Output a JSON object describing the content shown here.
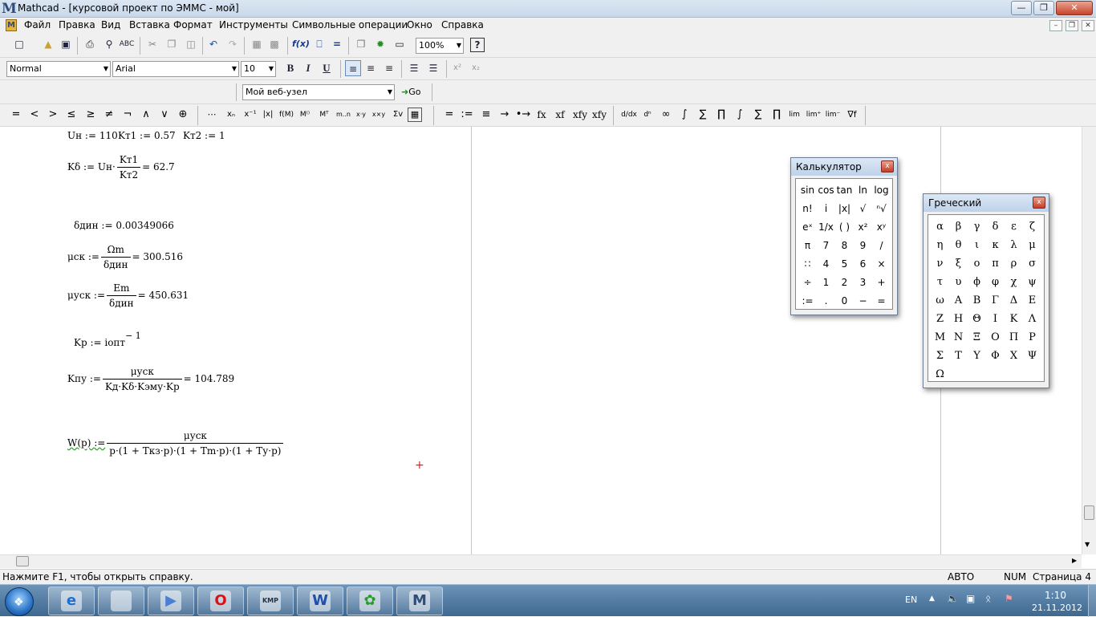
{
  "window": {
    "title": "Mathcad - [курсовой проект по ЭММС - мой]",
    "app_logo": "M",
    "controls": [
      "—",
      "❐",
      "✕"
    ]
  },
  "menu": [
    "Файл",
    "Правка",
    "Вид",
    "Вставка",
    "Формат",
    "Инструменты",
    "Символьные операции",
    "Окно",
    "Справка"
  ],
  "doc_controls": [
    "–",
    "❐",
    "✕"
  ],
  "toolbar": {
    "zoom": "100%",
    "help": "?"
  },
  "format_bar": {
    "style": "Normal",
    "font": "Arial",
    "size": "10",
    "bold": "B",
    "italic": "I",
    "underline": "U",
    "superscript": "x²",
    "subscript": "x₂"
  },
  "web_bar": {
    "site": "Мой веб-узел",
    "go": "Go"
  },
  "math_bar": {
    "boolean": [
      "=",
      "<",
      ">",
      "≤",
      "≥",
      "≠",
      "¬",
      "∧",
      "∨",
      "⊕"
    ],
    "evaluation": [
      "=",
      ":=",
      "≡",
      "→",
      "•→",
      "fx",
      "xf",
      "xfy",
      "xfy"
    ],
    "calculus": [
      "∫",
      "∑",
      "∏",
      "lim"
    ]
  },
  "worksheet": {
    "line1": {
      "a": "Uн := 110",
      "b": "Kт1 := 0.57",
      "c": "Kт2 := 1"
    },
    "kd": {
      "lhs": "Kδ := Uн·",
      "num": "Kт1",
      "den": "Kт2",
      "rhs": "= 62.7"
    },
    "ddin": "δдин := 0.00349066",
    "mu_sk": {
      "lhs": "μск :=",
      "num": "Ωm",
      "den": "δдин",
      "rhs": "= 300.516"
    },
    "mu_usk": {
      "lhs": "μуск :=",
      "num": "Em",
      "den": "δдин",
      "rhs": "= 450.631"
    },
    "kp": {
      "lhs": "Kp := iопт",
      "exp": "− 1"
    },
    "kpu": {
      "lhs": "Kпу :=",
      "num": "μуск",
      "den": "Kд·Kδ·Kэму·Kp",
      "rhs": "= 104.789"
    },
    "w": {
      "lhs": "W(p) :=",
      "num": "μуск",
      "den": "p·(1 + Tкз·p)·(1 + Tm·p)·(1 + Tу·p)"
    },
    "cursor": "+"
  },
  "calculator": {
    "title": "Калькулятор",
    "close": "x",
    "keys": [
      [
        "sin",
        "cos",
        "tan",
        "ln",
        "log"
      ],
      [
        "n!",
        "i",
        "|x|",
        "√",
        "ⁿ√"
      ],
      [
        "eˣ",
        "1/x",
        "( )",
        "x²",
        "xʸ"
      ],
      [
        "π",
        "7",
        "8",
        "9",
        "/"
      ],
      [
        "∷",
        "4",
        "5",
        "6",
        "×"
      ],
      [
        "÷",
        "1",
        "2",
        "3",
        "+"
      ],
      [
        ":=",
        ".",
        "0",
        "−",
        "="
      ]
    ]
  },
  "greek": {
    "title": "Греческий",
    "close": "x",
    "keys": [
      [
        "α",
        "β",
        "γ",
        "δ",
        "ε",
        "ζ"
      ],
      [
        "η",
        "θ",
        "ι",
        "κ",
        "λ",
        "μ"
      ],
      [
        "ν",
        "ξ",
        "ο",
        "π",
        "ρ",
        "σ"
      ],
      [
        "τ",
        "υ",
        "ϕ",
        "φ",
        "χ",
        "ψ"
      ],
      [
        "ω",
        "Α",
        "Β",
        "Γ",
        "Δ",
        "Ε"
      ],
      [
        "Ζ",
        "Η",
        "Θ",
        "Ι",
        "Κ",
        "Λ"
      ],
      [
        "Μ",
        "Ν",
        "Ξ",
        "Ο",
        "Π",
        "Ρ"
      ],
      [
        "Σ",
        "Τ",
        "Υ",
        "Φ",
        "Χ",
        "Ψ"
      ],
      [
        "Ω"
      ]
    ]
  },
  "status": {
    "help": "Нажмите F1, чтобы открыть справку.",
    "mode": "АВТО",
    "num": "NUM",
    "page": "Страница 4"
  },
  "taskbar": {
    "lang": "EN",
    "time": "1:10",
    "date": "21.11.2012",
    "apps": [
      {
        "label": "e",
        "icon": "internet-explorer-icon"
      },
      {
        "label": "",
        "icon": "folder-icon"
      },
      {
        "label": "▶",
        "icon": "media-player-icon"
      },
      {
        "label": "O",
        "icon": "opera-icon"
      },
      {
        "label": "KMP",
        "icon": "kmplayer-icon"
      },
      {
        "label": "W",
        "icon": "word-icon"
      },
      {
        "label": "✿",
        "icon": "icq-icon"
      },
      {
        "label": "M",
        "icon": "mathcad-icon"
      }
    ]
  }
}
